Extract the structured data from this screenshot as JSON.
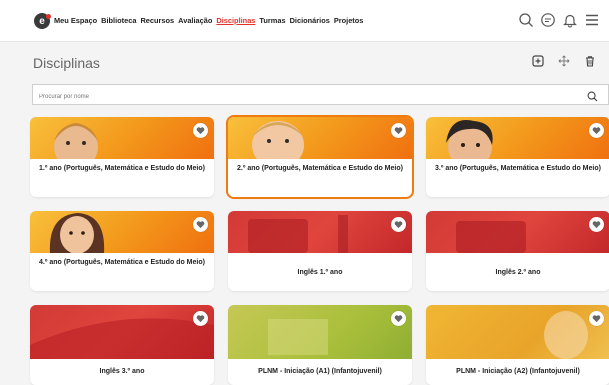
{
  "header": {
    "logo_letter": "e",
    "nav": [
      {
        "label": "Meu Espaço",
        "active": false
      },
      {
        "label": "Biblioteca",
        "active": false
      },
      {
        "label": "Recursos",
        "active": false
      },
      {
        "label": "Avaliação",
        "active": false
      },
      {
        "label": "Disciplinas",
        "active": true
      },
      {
        "label": "Turmas",
        "active": false
      },
      {
        "label": "Dicionários",
        "active": false
      },
      {
        "label": "Projetos",
        "active": false
      }
    ],
    "icons": [
      "search-icon",
      "chat-icon",
      "bell-icon",
      "menu-icon"
    ]
  },
  "page": {
    "title": "Disciplinas",
    "toolbar_icons": [
      "add-icon",
      "move-icon",
      "trash-icon"
    ]
  },
  "search": {
    "placeholder": "Procurar por nome"
  },
  "cards": [
    {
      "label": "1.º ano (Português, Matemática e Estudo do Meio)",
      "theme": "orange",
      "selected": false
    },
    {
      "label": "2.º ano (Português, Matemática e Estudo do Meio)",
      "theme": "orange",
      "selected": true
    },
    {
      "label": "3.º ano (Português, Matemática e Estudo do Meio)",
      "theme": "orange",
      "selected": false
    },
    {
      "label": "4.º ano (Português, Matemática e Estudo do Meio)",
      "theme": "orange",
      "selected": false
    },
    {
      "label": "Inglês 1.º ano",
      "theme": "red",
      "selected": false
    },
    {
      "label": "Inglês 2.º ano",
      "theme": "red",
      "selected": false
    },
    {
      "label": "Inglês 3.º ano",
      "theme": "red",
      "selected": false
    },
    {
      "label": "PLNM - Iniciação (A1) (Infantojuvenil)",
      "theme": "green",
      "selected": false
    },
    {
      "label": "PLNM - Iniciação (A2) (Infantojuvenil)",
      "theme": "amber",
      "selected": false
    }
  ],
  "colors": {
    "accent": "#e4312b",
    "selected_outline": "#f07b10"
  }
}
